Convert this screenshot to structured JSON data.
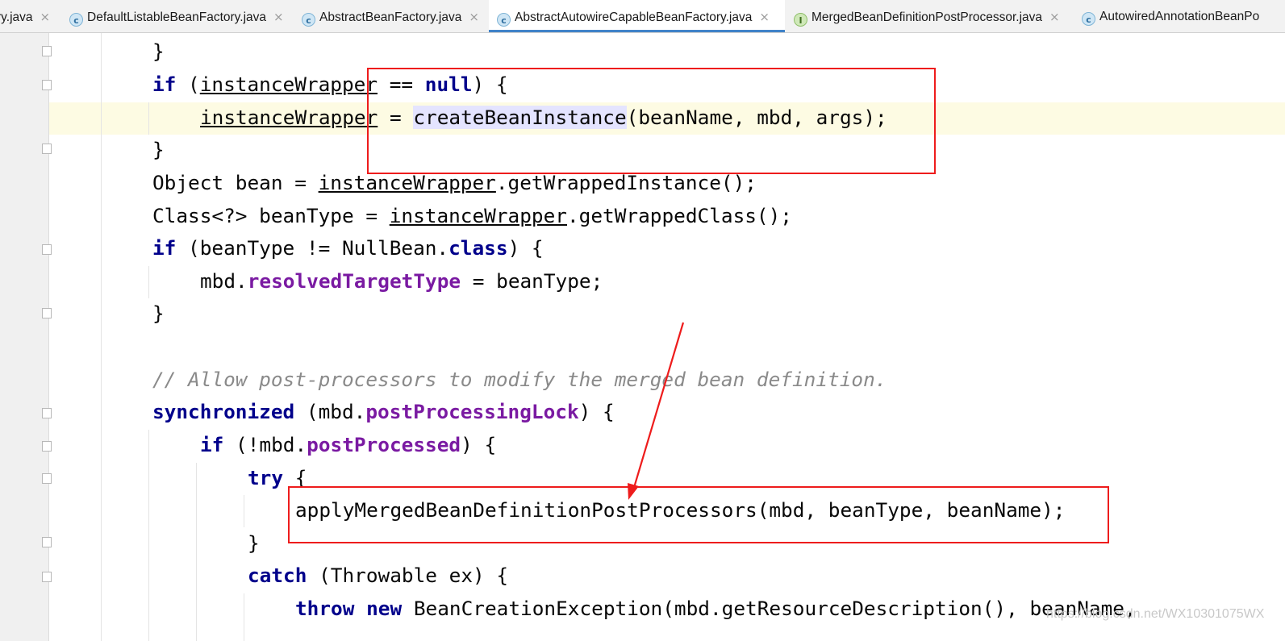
{
  "tabs": [
    {
      "label": "ry.java",
      "icon": "none",
      "active": false
    },
    {
      "label": "DefaultListableBeanFactory.java",
      "icon": "class-icon",
      "active": false
    },
    {
      "label": "AbstractBeanFactory.java",
      "icon": "class-icon",
      "active": false
    },
    {
      "label": "AbstractAutowireCapableBeanFactory.java",
      "icon": "class-icon",
      "active": true
    },
    {
      "label": "MergedBeanDefinitionPostProcessor.java",
      "icon": "interface-icon",
      "active": false
    },
    {
      "label": "AutowiredAnnotationBeanPo",
      "icon": "class-icon",
      "active": false
    }
  ],
  "icon_glyphs": {
    "class": "c",
    "interface": "I",
    "close": "×"
  },
  "code": {
    "l1": {
      "brace": "}"
    },
    "l2": {
      "kw_if": "if",
      "p1": " (",
      "var": "instanceWrapper",
      "p2": " == ",
      "kw_null": "null",
      "p3": ") {"
    },
    "l3": {
      "var": "instanceWrapper",
      "p1": " = ",
      "call": "createBeanInstance",
      "p2": "(beanName, mbd, args);"
    },
    "l4": {
      "brace": "}"
    },
    "l5": {
      "p1": "Object bean = ",
      "var": "instanceWrapper",
      "p2": ".getWrappedInstance();"
    },
    "l6": {
      "p1": "Class<?> beanType = ",
      "var": "instanceWrapper",
      "p2": ".getWrappedClass();"
    },
    "l7": {
      "kw_if": "if",
      "p1": " (beanType != NullBean.",
      "kw_class": "class",
      "p2": ") {"
    },
    "l8": {
      "p1": "mbd.",
      "field": "resolvedTargetType",
      "p2": " = beanType;"
    },
    "l9": {
      "brace": "}"
    },
    "l10": {
      "comment": "// Allow post-processors to modify the merged bean definition."
    },
    "l11": {
      "kw": "synchronized",
      "p1": " (mbd.",
      "field": "postProcessingLock",
      "p2": ") {"
    },
    "l12": {
      "kw": "if",
      "p1": " (!mbd.",
      "field": "postProcessed",
      "p2": ") {"
    },
    "l13": {
      "kw": "try",
      "p1": " {"
    },
    "l14": {
      "text": "applyMergedBeanDefinitionPostProcessors(mbd, beanType, beanName);"
    },
    "l15": {
      "brace": "}"
    },
    "l16": {
      "kw": "catch",
      "p1": " (Throwable ex) {"
    },
    "l17": {
      "kw_throw": "throw",
      "sp": " ",
      "kw_new": "new",
      "p1": " BeanCreationException(mbd.getResourceDescription(), beanName,"
    }
  },
  "annotation_color": "#ee1c1c",
  "watermark": "https://blog.csdn.net/WX10301075WX"
}
